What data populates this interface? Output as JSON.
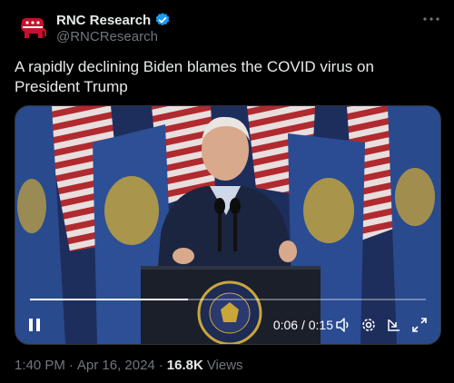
{
  "author": {
    "display_name": "RNC Research",
    "handle": "@RNCResearch",
    "avatar_icon": "gop-elephant-icon",
    "verified_icon": "verified-badge-icon",
    "brand_color": "#c8102e",
    "verified_color": "#1d9bf0"
  },
  "tweet": {
    "text": "A rapidly declining Biden blames the COVID virus on President Trump",
    "more_icon": "more-dots-icon"
  },
  "video": {
    "current_time": "0:06",
    "separator": "/",
    "duration": "0:15",
    "progress": 0.4,
    "seal_text": "PRESIDENT OF THE UNITED STATES",
    "icons": {
      "pause": "pause-icon",
      "volume": "volume-icon",
      "settings": "settings-icon",
      "pip": "picture-in-picture-icon",
      "fullscreen": "fullscreen-icon"
    }
  },
  "footer": {
    "time": "1:40 PM",
    "dot1": "·",
    "date": "Apr 16, 2024",
    "dot2": "·",
    "views_count": "16.8K",
    "views_label": "Views"
  }
}
